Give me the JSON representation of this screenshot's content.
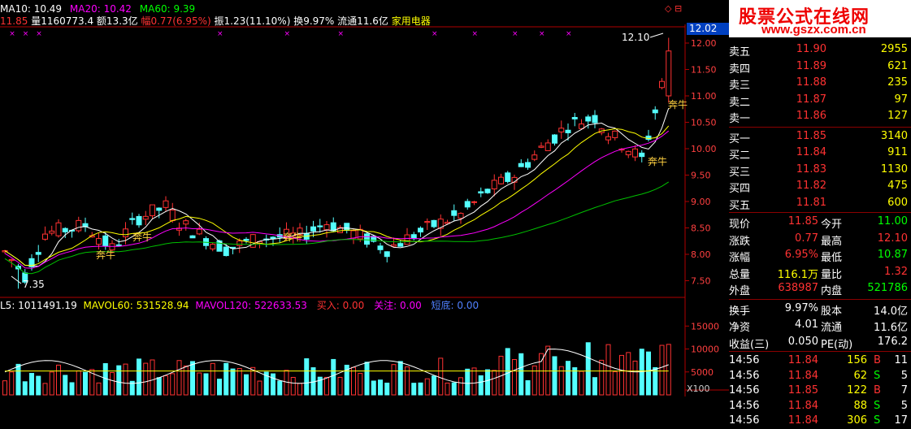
{
  "header": {
    "ma10": "MA10: 10.49",
    "ma20": "MA20: 10.42",
    "ma60": "MA60: 9.39",
    "price": "11.85",
    "volume": "量1160773.4",
    "amount": "额13.3亿",
    "change": "幅0.77(6.95%)",
    "amplitude": "振1.23(11.10%)",
    "turnover": "换9.97%",
    "float": "流通11.6亿",
    "sector": "家用电器"
  },
  "price_chart": {
    "high_label": "12.10",
    "low_label": "7.35",
    "current_tag": "12.02",
    "signal_label": "奔牛",
    "y_ticks": [
      "12.00",
      "11.50",
      "11.00",
      "10.50",
      "10.00",
      "9.50",
      "9.00",
      "8.50",
      "8.00",
      "7.50"
    ],
    "top_right_icons": "◇ ⊟"
  },
  "volume_chart": {
    "ma_vol5": "L5: 1011491.19",
    "ma_vol60": "MAVOL60: 531528.94",
    "ma_vol120": "MAVOL120: 522633.53",
    "buy_label": "买入: 0.00",
    "watch_label": "关注: 0.00",
    "short_label": "短底: 0.00",
    "y_ticks": [
      "15000",
      "10000",
      "5000"
    ],
    "unit": "X100"
  },
  "logo": {
    "title": "股票公式在线网",
    "url": "www.gszx.com.cn"
  },
  "order_book": {
    "asks": [
      {
        "label": "卖五",
        "price": "11.90",
        "vol": "2955"
      },
      {
        "label": "卖四",
        "price": "11.89",
        "vol": "621"
      },
      {
        "label": "卖三",
        "price": "11.88",
        "vol": "235"
      },
      {
        "label": "卖二",
        "price": "11.87",
        "vol": "97"
      },
      {
        "label": "卖一",
        "price": "11.86",
        "vol": "127"
      }
    ],
    "bids": [
      {
        "label": "买一",
        "price": "11.85",
        "vol": "3140"
      },
      {
        "label": "买二",
        "price": "11.84",
        "vol": "911"
      },
      {
        "label": "买三",
        "price": "11.83",
        "vol": "1130"
      },
      {
        "label": "买四",
        "price": "11.82",
        "vol": "475"
      },
      {
        "label": "买五",
        "price": "11.81",
        "vol": "600"
      }
    ]
  },
  "quote": [
    {
      "l1": "现价",
      "v1": "11.85",
      "l2": "今开",
      "v2": "11.00"
    },
    {
      "l1": "涨跌",
      "v1": "0.77",
      "l2": "最高",
      "v2": "12.10"
    },
    {
      "l1": "涨幅",
      "v1": "6.95%",
      "l2": "最低",
      "v2": "10.87"
    },
    {
      "l1": "总量",
      "v1": "116.1万",
      "l2": "量比",
      "v2": "1.32"
    },
    {
      "l1": "外盘",
      "v1": "638987",
      "l2": "内盘",
      "v2": "521786"
    }
  ],
  "stats": [
    {
      "l1": "换手",
      "v1": "9.97%",
      "l2": "股本",
      "v2": "14.0亿"
    },
    {
      "l1": "净资",
      "v1": "4.01",
      "l2": "流通",
      "v2": "11.6亿"
    },
    {
      "l1": "收益(三)",
      "v1": "0.050",
      "l2": "PE(动)",
      "v2": "176.2"
    }
  ],
  "ticks": [
    {
      "time": "14:56",
      "price": "11.84",
      "vol": "156",
      "side": "B",
      "n": "11"
    },
    {
      "time": "14:56",
      "price": "11.84",
      "vol": "62",
      "side": "S",
      "n": "5"
    },
    {
      "time": "14:56",
      "price": "11.85",
      "vol": "122",
      "side": "B",
      "n": "7"
    },
    {
      "time": "14:56",
      "price": "11.84",
      "vol": "88",
      "side": "S",
      "n": "5"
    },
    {
      "time": "14:56",
      "price": "11.84",
      "vol": "306",
      "side": "S",
      "n": "17"
    }
  ],
  "colors": {
    "up": "#ff3232",
    "down": "#54ffff",
    "ma10": "#ffffff",
    "ma20": "#ffff00",
    "ma60": "#ff00ff",
    "ma120": "#00c000",
    "axis": "#b00000"
  }
}
